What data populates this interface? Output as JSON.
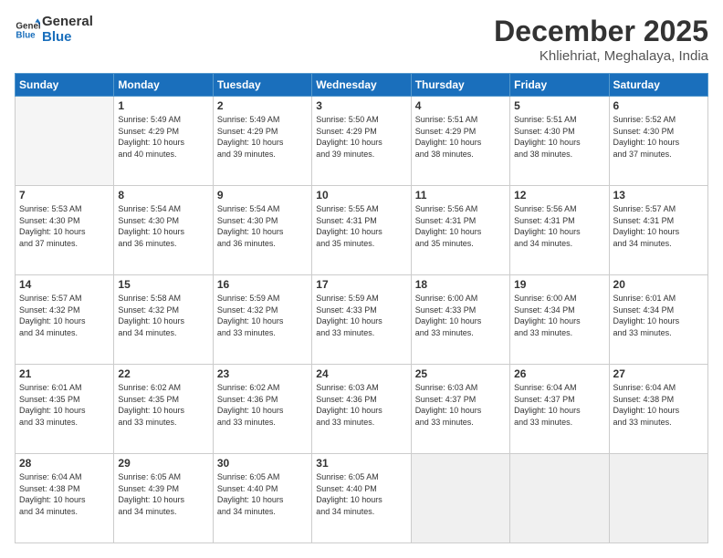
{
  "logo": {
    "line1": "General",
    "line2": "Blue"
  },
  "header": {
    "month": "December 2025",
    "location": "Khliehriat, Meghalaya, India"
  },
  "weekdays": [
    "Sunday",
    "Monday",
    "Tuesday",
    "Wednesday",
    "Thursday",
    "Friday",
    "Saturday"
  ],
  "weeks": [
    [
      {
        "day": "",
        "info": ""
      },
      {
        "day": "1",
        "info": "Sunrise: 5:49 AM\nSunset: 4:29 PM\nDaylight: 10 hours\nand 40 minutes."
      },
      {
        "day": "2",
        "info": "Sunrise: 5:49 AM\nSunset: 4:29 PM\nDaylight: 10 hours\nand 39 minutes."
      },
      {
        "day": "3",
        "info": "Sunrise: 5:50 AM\nSunset: 4:29 PM\nDaylight: 10 hours\nand 39 minutes."
      },
      {
        "day": "4",
        "info": "Sunrise: 5:51 AM\nSunset: 4:29 PM\nDaylight: 10 hours\nand 38 minutes."
      },
      {
        "day": "5",
        "info": "Sunrise: 5:51 AM\nSunset: 4:30 PM\nDaylight: 10 hours\nand 38 minutes."
      },
      {
        "day": "6",
        "info": "Sunrise: 5:52 AM\nSunset: 4:30 PM\nDaylight: 10 hours\nand 37 minutes."
      }
    ],
    [
      {
        "day": "7",
        "info": "Sunrise: 5:53 AM\nSunset: 4:30 PM\nDaylight: 10 hours\nand 37 minutes."
      },
      {
        "day": "8",
        "info": "Sunrise: 5:54 AM\nSunset: 4:30 PM\nDaylight: 10 hours\nand 36 minutes."
      },
      {
        "day": "9",
        "info": "Sunrise: 5:54 AM\nSunset: 4:30 PM\nDaylight: 10 hours\nand 36 minutes."
      },
      {
        "day": "10",
        "info": "Sunrise: 5:55 AM\nSunset: 4:31 PM\nDaylight: 10 hours\nand 35 minutes."
      },
      {
        "day": "11",
        "info": "Sunrise: 5:56 AM\nSunset: 4:31 PM\nDaylight: 10 hours\nand 35 minutes."
      },
      {
        "day": "12",
        "info": "Sunrise: 5:56 AM\nSunset: 4:31 PM\nDaylight: 10 hours\nand 34 minutes."
      },
      {
        "day": "13",
        "info": "Sunrise: 5:57 AM\nSunset: 4:31 PM\nDaylight: 10 hours\nand 34 minutes."
      }
    ],
    [
      {
        "day": "14",
        "info": "Sunrise: 5:57 AM\nSunset: 4:32 PM\nDaylight: 10 hours\nand 34 minutes."
      },
      {
        "day": "15",
        "info": "Sunrise: 5:58 AM\nSunset: 4:32 PM\nDaylight: 10 hours\nand 34 minutes."
      },
      {
        "day": "16",
        "info": "Sunrise: 5:59 AM\nSunset: 4:32 PM\nDaylight: 10 hours\nand 33 minutes."
      },
      {
        "day": "17",
        "info": "Sunrise: 5:59 AM\nSunset: 4:33 PM\nDaylight: 10 hours\nand 33 minutes."
      },
      {
        "day": "18",
        "info": "Sunrise: 6:00 AM\nSunset: 4:33 PM\nDaylight: 10 hours\nand 33 minutes."
      },
      {
        "day": "19",
        "info": "Sunrise: 6:00 AM\nSunset: 4:34 PM\nDaylight: 10 hours\nand 33 minutes."
      },
      {
        "day": "20",
        "info": "Sunrise: 6:01 AM\nSunset: 4:34 PM\nDaylight: 10 hours\nand 33 minutes."
      }
    ],
    [
      {
        "day": "21",
        "info": "Sunrise: 6:01 AM\nSunset: 4:35 PM\nDaylight: 10 hours\nand 33 minutes."
      },
      {
        "day": "22",
        "info": "Sunrise: 6:02 AM\nSunset: 4:35 PM\nDaylight: 10 hours\nand 33 minutes."
      },
      {
        "day": "23",
        "info": "Sunrise: 6:02 AM\nSunset: 4:36 PM\nDaylight: 10 hours\nand 33 minutes."
      },
      {
        "day": "24",
        "info": "Sunrise: 6:03 AM\nSunset: 4:36 PM\nDaylight: 10 hours\nand 33 minutes."
      },
      {
        "day": "25",
        "info": "Sunrise: 6:03 AM\nSunset: 4:37 PM\nDaylight: 10 hours\nand 33 minutes."
      },
      {
        "day": "26",
        "info": "Sunrise: 6:04 AM\nSunset: 4:37 PM\nDaylight: 10 hours\nand 33 minutes."
      },
      {
        "day": "27",
        "info": "Sunrise: 6:04 AM\nSunset: 4:38 PM\nDaylight: 10 hours\nand 33 minutes."
      }
    ],
    [
      {
        "day": "28",
        "info": "Sunrise: 6:04 AM\nSunset: 4:38 PM\nDaylight: 10 hours\nand 34 minutes."
      },
      {
        "day": "29",
        "info": "Sunrise: 6:05 AM\nSunset: 4:39 PM\nDaylight: 10 hours\nand 34 minutes."
      },
      {
        "day": "30",
        "info": "Sunrise: 6:05 AM\nSunset: 4:40 PM\nDaylight: 10 hours\nand 34 minutes."
      },
      {
        "day": "31",
        "info": "Sunrise: 6:05 AM\nSunset: 4:40 PM\nDaylight: 10 hours\nand 34 minutes."
      },
      {
        "day": "",
        "info": ""
      },
      {
        "day": "",
        "info": ""
      },
      {
        "day": "",
        "info": ""
      }
    ]
  ]
}
